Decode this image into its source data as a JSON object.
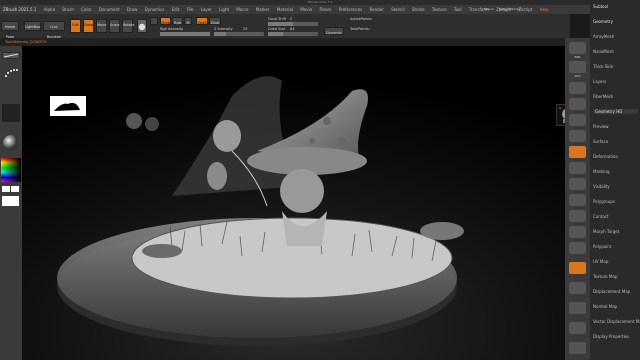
{
  "window": {
    "title": "ZBrush 2021.5.1"
  },
  "menubar": {
    "file_title": "ZBrush 2021.5.1",
    "items": [
      "Alpha",
      "Brush",
      "Color",
      "Document",
      "Draw",
      "Dynamics",
      "Edit",
      "File",
      "Layer",
      "Light",
      "Macro",
      "Marker",
      "Material",
      "Movie",
      "Picker",
      "Preferences",
      "Render",
      "Stencil",
      "Stroke",
      "Texture",
      "Tool",
      "Transform",
      "Zplugin",
      "Zscript",
      "Help"
    ],
    "right_items": [
      "Menus",
      "DefaultZScript"
    ]
  },
  "toolbar": {
    "buttons": [
      "LightBox",
      "Live Boolean",
      "Edit",
      "Draw",
      "Move",
      "Scale",
      "Rotate"
    ],
    "mrgb": "Mrgb",
    "rgb": "Rgb",
    "m": "M",
    "zadd": "Zadd",
    "zsub": "Zsub",
    "focal_shift_label": "Focal Shift",
    "focal_shift_value": "0",
    "draw_size_label": "Draw Size",
    "draw_size_value": "64",
    "rgb_intensity_label": "Rgb Intensity",
    "rgb_intensity_value": "100",
    "z_intensity_label": "Z Intensity",
    "z_intensity_value": "25",
    "dynamic_label": "Dynamic",
    "active_points_label": "ActivePoints:",
    "total_points_label": "TotalPoints:"
  },
  "status": {
    "text": "Tool:Vivienne_OCWITCH"
  },
  "left_shelf": {
    "btn1": "Home Page",
    "btn2": "Lightbox"
  },
  "right_shelf": {
    "items": [
      "BPR",
      "SPix",
      "Scroll",
      "Zoom",
      "Actual",
      "AAHalf",
      "Persp",
      "Floor",
      "Local",
      "Frame",
      "Move",
      "Scale",
      "Rotate",
      "Line Fill",
      "PolyF",
      "Transp",
      "Ghost",
      "Solo",
      "Xpose"
    ]
  },
  "tray": {
    "items": [
      {
        "label": "Subtool",
        "type": "hd"
      },
      {
        "label": "Geometry",
        "type": "hd"
      },
      {
        "label": "ArrayMesh",
        "type": "ti"
      },
      {
        "label": "NanoMesh",
        "type": "ti"
      },
      {
        "label": "Thick Skin",
        "type": "ti"
      },
      {
        "label": "Layers",
        "type": "ti"
      },
      {
        "label": "FiberMesh",
        "type": "ti"
      },
      {
        "label": "Geometry HD",
        "type": "sub"
      },
      {
        "label": "Preview",
        "type": "ti"
      },
      {
        "label": "Surface",
        "type": "ti"
      },
      {
        "label": "Deformation",
        "type": "ti"
      },
      {
        "label": "Masking",
        "type": "ti"
      },
      {
        "label": "Visibility",
        "type": "ti"
      },
      {
        "label": "Polygroups",
        "type": "ti"
      },
      {
        "label": "Contact",
        "type": "ti"
      },
      {
        "label": "Morph Target",
        "type": "ti"
      },
      {
        "label": "Polypaint",
        "type": "ti"
      },
      {
        "label": "UV Map",
        "type": "ti"
      },
      {
        "label": "Texture Map",
        "type": "ti"
      },
      {
        "label": "Displacement Map",
        "type": "ti"
      },
      {
        "label": "Normal Map",
        "type": "ti"
      },
      {
        "label": "Vector Displacement Map",
        "type": "ti"
      },
      {
        "label": "Display Properties",
        "type": "ti"
      }
    ]
  },
  "colors": {
    "accent": "#d9761e",
    "bg": "#1a1a1a",
    "panel": "#3b3b3b"
  }
}
